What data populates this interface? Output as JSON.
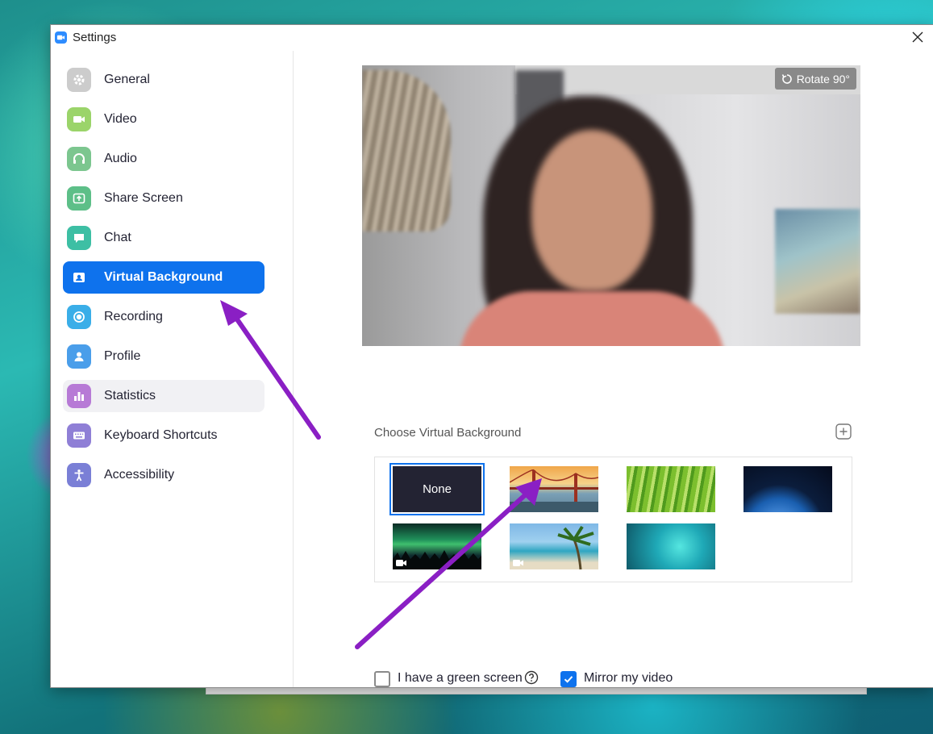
{
  "window": {
    "title": "Settings"
  },
  "sidebar": {
    "items": [
      {
        "label": "General",
        "icon": "gear-icon",
        "color": "#cccccc"
      },
      {
        "label": "Video",
        "icon": "video-icon",
        "color": "#9bd46a"
      },
      {
        "label": "Audio",
        "icon": "headphones-icon",
        "color": "#7cc68f"
      },
      {
        "label": "Share Screen",
        "icon": "share-screen-icon",
        "color": "#5dbf88"
      },
      {
        "label": "Chat",
        "icon": "chat-icon",
        "color": "#3dbfa4"
      },
      {
        "label": "Virtual Background",
        "icon": "person-frame-icon",
        "color": "#0e72ed",
        "active": true
      },
      {
        "label": "Recording",
        "icon": "record-icon",
        "color": "#3aaee8"
      },
      {
        "label": "Profile",
        "icon": "profile-icon",
        "color": "#4a9eea"
      },
      {
        "label": "Statistics",
        "icon": "bar-chart-icon",
        "color": "#b77ad6"
      },
      {
        "label": "Keyboard Shortcuts",
        "icon": "keyboard-icon",
        "color": "#8f7fd6"
      },
      {
        "label": "Accessibility",
        "icon": "accessibility-icon",
        "color": "#7a7fd6"
      }
    ]
  },
  "preview": {
    "rotate_label": "Rotate 90°"
  },
  "virtual_background": {
    "heading": "Choose Virtual Background",
    "options": [
      {
        "label": "None",
        "kind": "none",
        "selected": true
      },
      {
        "label": "",
        "kind": "golden-gate-bridge"
      },
      {
        "label": "",
        "kind": "grass"
      },
      {
        "label": "",
        "kind": "earth-from-space"
      },
      {
        "label": "",
        "kind": "aurora-video"
      },
      {
        "label": "",
        "kind": "beach-video"
      },
      {
        "label": "",
        "kind": "fantasy-forest"
      }
    ]
  },
  "options": {
    "green_screen_label": "I have a green screen",
    "green_screen_checked": false,
    "mirror_label": "Mirror my video",
    "mirror_checked": true
  },
  "colors": {
    "accent": "#0e72ed",
    "annotation_arrow": "#8a1fc4"
  }
}
